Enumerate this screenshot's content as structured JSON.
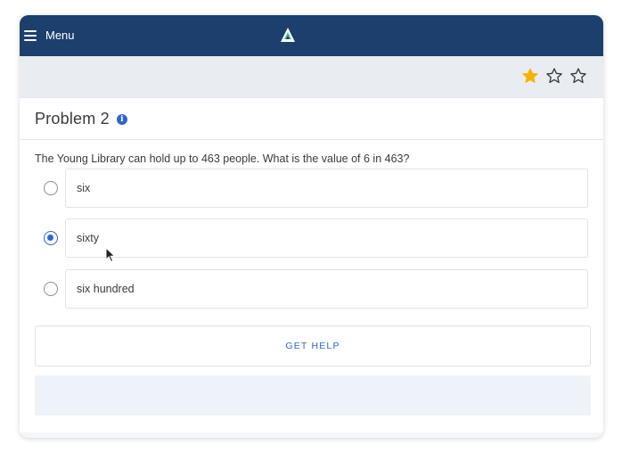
{
  "header": {
    "menu_label": "Menu",
    "logo_icon": "app-logo-icon",
    "background_color": "#1c3f6e"
  },
  "rating": {
    "stars_total": 3,
    "stars_filled": 1,
    "filled_color": "#f5b301"
  },
  "problem": {
    "title": "Problem 2",
    "info_icon": "info-icon",
    "question": "The Young Library can hold up to 463 people. What is the value of 6 in 463?"
  },
  "options": [
    {
      "label": "six",
      "selected": false
    },
    {
      "label": "sixty",
      "selected": true
    },
    {
      "label": "six hundred",
      "selected": false
    }
  ],
  "help": {
    "button_label": "GET HELP"
  },
  "accent_color": "#2f66c9"
}
